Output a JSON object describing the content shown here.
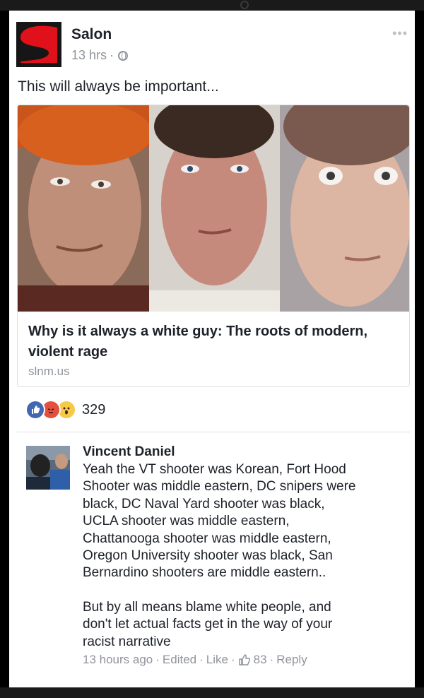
{
  "post": {
    "page_name": "Salon",
    "time": "13 hrs",
    "dot": "·",
    "privacy_icon": "globe-icon",
    "more_icon": "ellipsis-icon",
    "more_text": "•••",
    "text": "This will always be important..."
  },
  "link": {
    "title": "Why is it always a white guy: The roots of modern, violent rage",
    "domain": "slnm.us"
  },
  "reactions": {
    "icons": [
      "like-reaction-icon",
      "angry-reaction-icon",
      "wow-reaction-icon"
    ],
    "count": "329"
  },
  "comment": {
    "author": "Vincent Daniel",
    "lines": [
      "Yeah the VT shooter was Korean, Fort Hood",
      "Shooter was middle eastern, DC snipers were",
      "black, DC Naval Yard shooter was black,",
      "UCLA shooter was middle eastern,",
      "Chattanooga shooter was middle eastern,",
      "Oregon University shooter was black, San",
      "Bernardino shooters are middle eastern.."
    ],
    "lines2": [
      "But by all means blame white people, and",
      "don't let actual facts get in the way of your",
      "racist narrative"
    ],
    "time": "13 hours ago",
    "edited": "Edited",
    "like": "Like",
    "like_count": "83",
    "reply": "Reply",
    "sep": "·"
  },
  "colors": {
    "text": "#1d2129",
    "muted": "#90949c",
    "brand_red": "#e0111b",
    "like_blue": "#4267b2"
  }
}
